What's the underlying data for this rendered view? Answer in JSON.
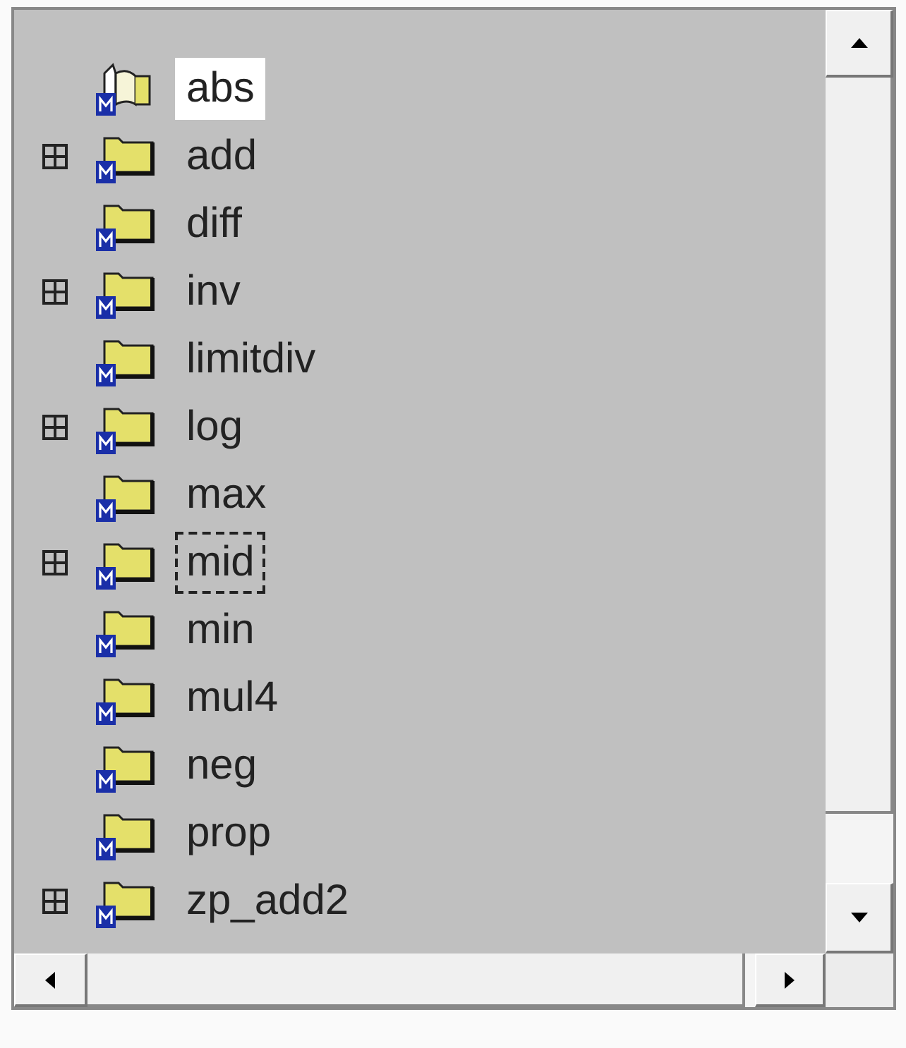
{
  "tree": {
    "items": [
      {
        "label": "abs",
        "kind": "book",
        "expandable": false,
        "selected": true,
        "focused": false
      },
      {
        "label": "add",
        "kind": "folder",
        "expandable": true,
        "selected": false,
        "focused": false
      },
      {
        "label": "diff",
        "kind": "folder",
        "expandable": false,
        "selected": false,
        "focused": false
      },
      {
        "label": "inv",
        "kind": "folder",
        "expandable": true,
        "selected": false,
        "focused": false
      },
      {
        "label": "limitdiv",
        "kind": "folder",
        "expandable": false,
        "selected": false,
        "focused": false
      },
      {
        "label": "log",
        "kind": "folder",
        "expandable": true,
        "selected": false,
        "focused": false
      },
      {
        "label": "max",
        "kind": "folder",
        "expandable": false,
        "selected": false,
        "focused": false
      },
      {
        "label": "mid",
        "kind": "folder",
        "expandable": true,
        "selected": false,
        "focused": true
      },
      {
        "label": "min",
        "kind": "folder",
        "expandable": false,
        "selected": false,
        "focused": false
      },
      {
        "label": "mul4",
        "kind": "folder",
        "expandable": false,
        "selected": false,
        "focused": false
      },
      {
        "label": "neg",
        "kind": "folder",
        "expandable": false,
        "selected": false,
        "focused": false
      },
      {
        "label": "prop",
        "kind": "folder",
        "expandable": false,
        "selected": false,
        "focused": false
      },
      {
        "label": "zp_add2",
        "kind": "folder",
        "expandable": true,
        "selected": false,
        "focused": false
      }
    ]
  }
}
